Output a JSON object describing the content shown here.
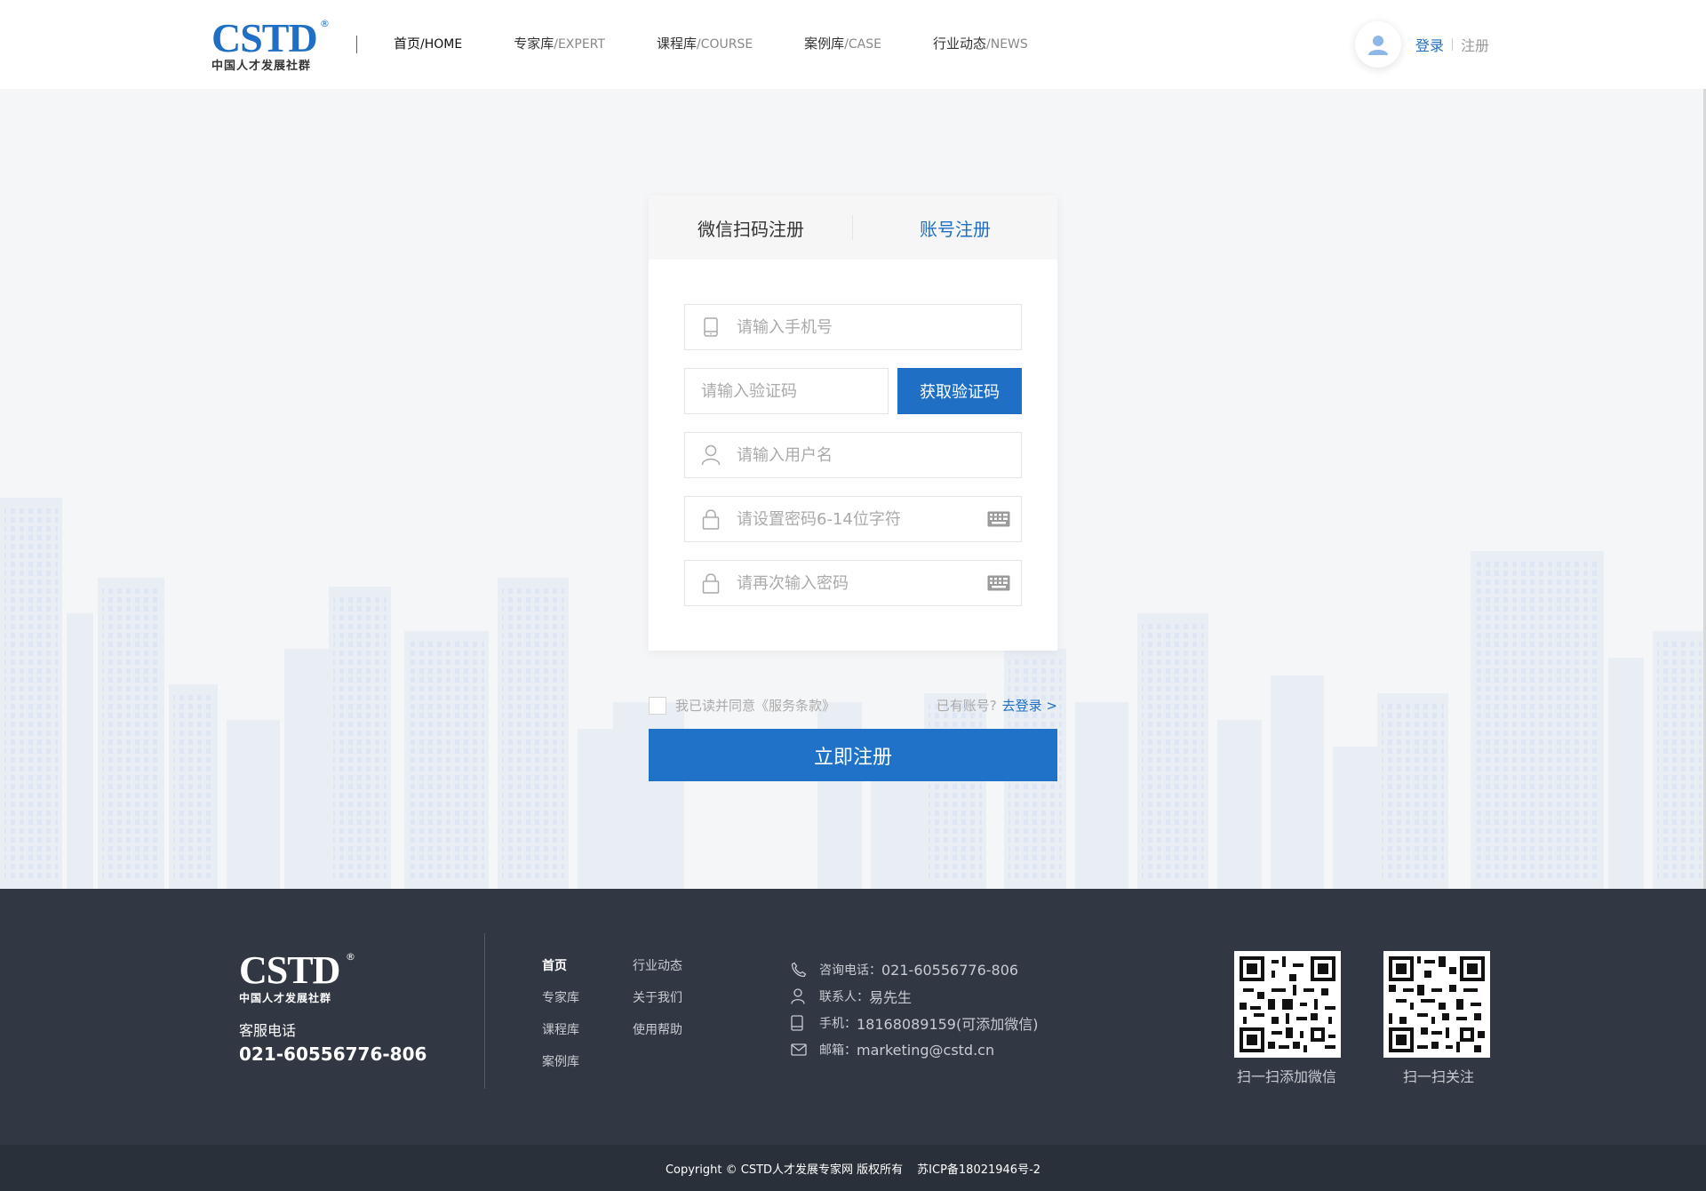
{
  "header": {
    "logo_text": "CSTD",
    "logo_reg": "®",
    "logo_sub": "中国人才发展社群",
    "nav": [
      {
        "cn": "首页",
        "en": "/HOME"
      },
      {
        "cn": "专家库",
        "en": "/EXPERT"
      },
      {
        "cn": "课程库",
        "en": "/COURSE"
      },
      {
        "cn": "案例库",
        "en": "/CASE"
      },
      {
        "cn": "行业动态",
        "en": "/NEWS"
      }
    ],
    "login": "登录",
    "register": "注册"
  },
  "card": {
    "tabs": [
      "微信扫码注册",
      "账号注册"
    ],
    "active_tab": "账号注册",
    "phone_placeholder": "请输入手机号",
    "code_placeholder": "请输入验证码",
    "code_button": "获取验证码",
    "username_placeholder": "请输入用户名",
    "password_placeholder": "请设置密码6-14位字符",
    "confirm_placeholder": "请再次输入密码"
  },
  "agree": {
    "text": "我已读并同意《服务条款》",
    "have_account": "已有账号?",
    "go_login": "去登录 >"
  },
  "submit": "立即注册",
  "footer": {
    "phone_label": "客服电话",
    "phone": "021-60556776-806",
    "links": [
      "首页",
      "行业动态",
      "专家库",
      "关于我们",
      "课程库",
      "使用帮助",
      "案例库"
    ],
    "contact": [
      {
        "icon": "phone-icon",
        "label": "咨询电话：",
        "value": "021-60556776-806"
      },
      {
        "icon": "person-icon",
        "label": "联系人：",
        "value": "易先生"
      },
      {
        "icon": "mobile-icon",
        "label": "手机：",
        "value": "18168089159(可添加微信)"
      },
      {
        "icon": "mail-icon",
        "label": "邮箱：",
        "value": "marketing@cstd.cn"
      }
    ],
    "qr_captions": [
      "扫一扫添加微信",
      "扫一扫关注"
    ],
    "copyright": "Copyright © CSTD人才发展专家网 版权所有",
    "icp": "苏ICP备18021946号-2"
  },
  "colors": {
    "brand": "#1f6fc4",
    "footer_bg": "#313843"
  }
}
